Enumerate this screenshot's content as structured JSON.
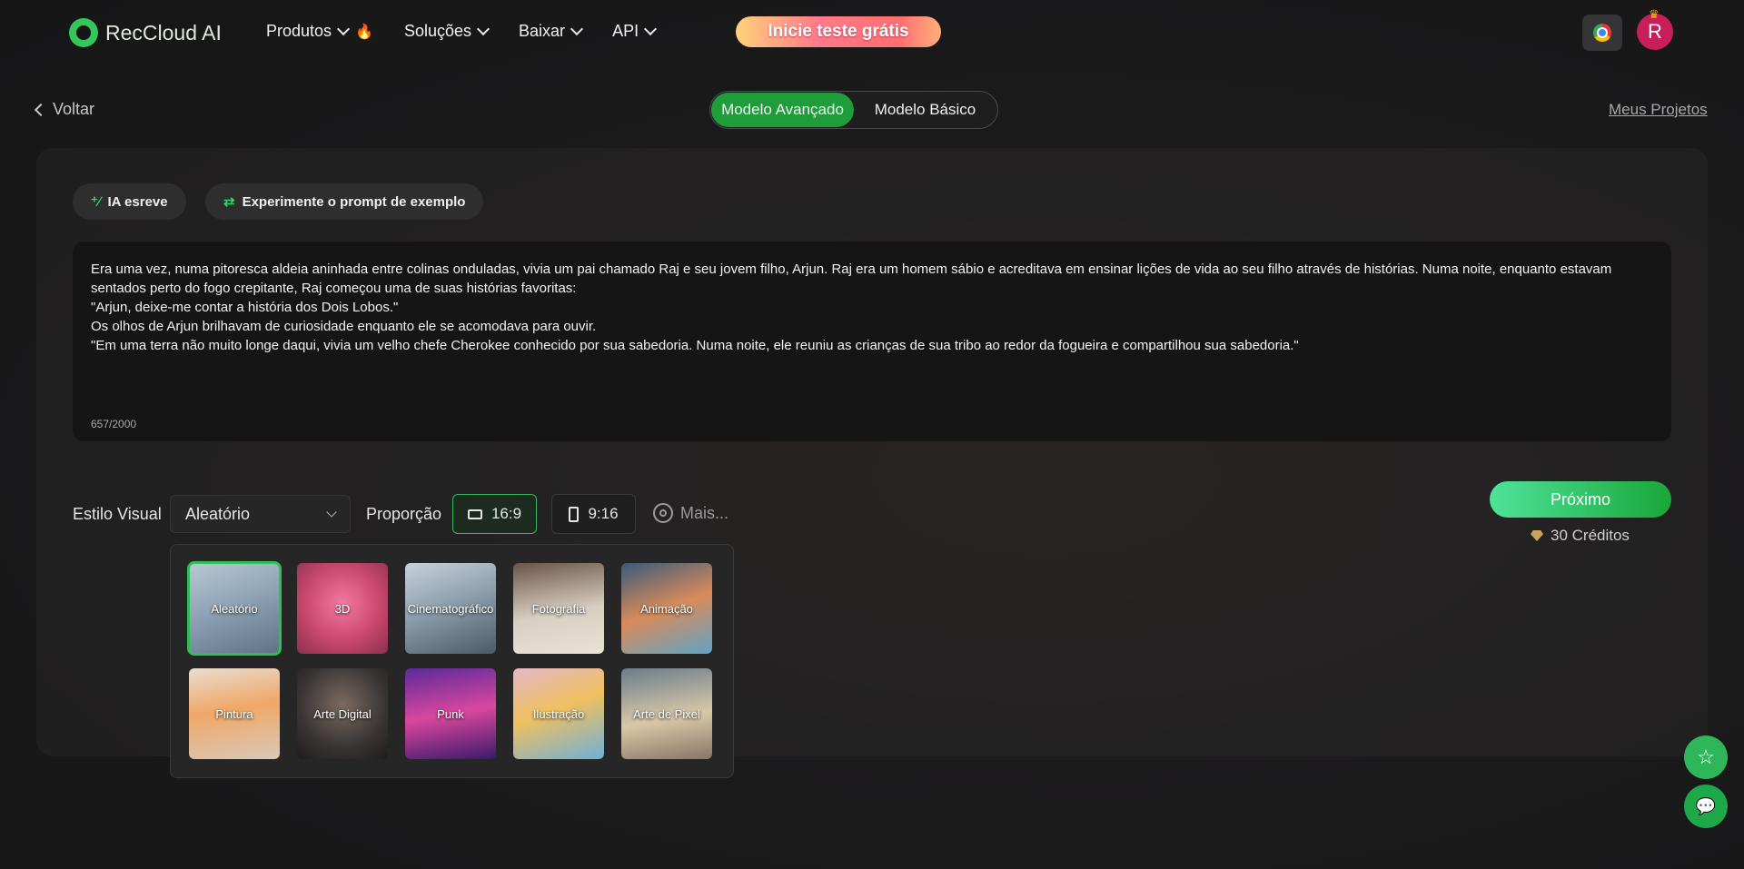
{
  "header": {
    "logo": "RecCloud AI",
    "nav": [
      {
        "label": "Produtos",
        "hot": true
      },
      {
        "label": "Soluções",
        "hot": false
      },
      {
        "label": "Baixar",
        "hot": false
      },
      {
        "label": "API",
        "hot": false
      }
    ],
    "trial_label": "Inicie teste grátis",
    "avatar_letter": "R"
  },
  "subheader": {
    "back_label": "Voltar",
    "modes": [
      {
        "label": "Modelo Avançado",
        "active": true
      },
      {
        "label": "Modelo Básico",
        "active": false
      }
    ],
    "projects_label": "Meus Projetos"
  },
  "editor": {
    "ai_write_label": "IA esreve",
    "example_prompt_label": "Experimente o prompt de exemplo",
    "story": "Era uma vez, numa pitoresca aldeia aninhada entre colinas onduladas, vivia um pai chamado Raj e seu jovem filho, Arjun. Raj era um homem sábio e acreditava em ensinar lições de vida ao seu filho através de histórias. Numa noite, enquanto estavam sentados perto do fogo crepitante, Raj começou uma de suas histórias favoritas:\n\"Arjun, deixe-me contar a história dos Dois Lobos.\"\nOs olhos de Arjun brilhavam de curiosidade enquanto ele se acomodava para ouvir.\n\"Em uma terra não muito longe daqui, vivia um velho chefe Cherokee conhecido por sua sabedoria. Numa noite, ele reuniu as crianças de sua tribo ao redor da fogueira e compartilhou sua sabedoria.\"",
    "counter": "657/2000"
  },
  "controls": {
    "style_label": "Estilo Visual",
    "style_value": "Aleatório",
    "ratio_label": "Proporção",
    "ratios": [
      {
        "label": "16:9",
        "selected": true
      },
      {
        "label": "9:16",
        "selected": false
      }
    ],
    "more_label": "Mais...",
    "next_label": "Próximo",
    "credits": "30 Créditos"
  },
  "styles": [
    {
      "label": "Aleatório",
      "selected": true,
      "bg": "linear-gradient(160deg,#b9c9d6,#8aa0b2 50%,#5d7386)"
    },
    {
      "label": "3D",
      "selected": false,
      "bg": "radial-gradient(circle at 50% 45%,#f37aa0,#c9486e 55%,#8a3050)"
    },
    {
      "label": "Cinematográfico",
      "selected": false,
      "bg": "linear-gradient(160deg,#c7d3dc,#8ea0ae 45%,#4b5a66)"
    },
    {
      "label": "Fotografia",
      "selected": false,
      "bg": "linear-gradient(170deg,#6b5446,#d8cfc2 55%,#e9e2d6)"
    },
    {
      "label": "Animação",
      "selected": false,
      "bg": "linear-gradient(160deg,#3a5a7a,#d98b5a 50%,#5fa3c8)"
    },
    {
      "label": "Pintura",
      "selected": false,
      "bg": "linear-gradient(170deg,#e8ddd0,#f0a867 45%,#d9c8b8)"
    },
    {
      "label": "Arte Digital",
      "selected": false,
      "bg": "radial-gradient(circle at 50% 40%,#7b6a60,#3a3535 60%,#1e1c1c)"
    },
    {
      "label": "Punk",
      "selected": false,
      "bg": "linear-gradient(170deg,#5a2a9a,#d9479e 50%,#3a1a6a)"
    },
    {
      "label": "Ilustração",
      "selected": false,
      "bg": "linear-gradient(160deg,#e4b8c8,#f0c060 45%,#6fb0d8)"
    },
    {
      "label": "Arte de Pixel",
      "selected": false,
      "bg": "linear-gradient(170deg,#6a7d8a,#d9c8a8 55%,#8a7565)"
    }
  ]
}
